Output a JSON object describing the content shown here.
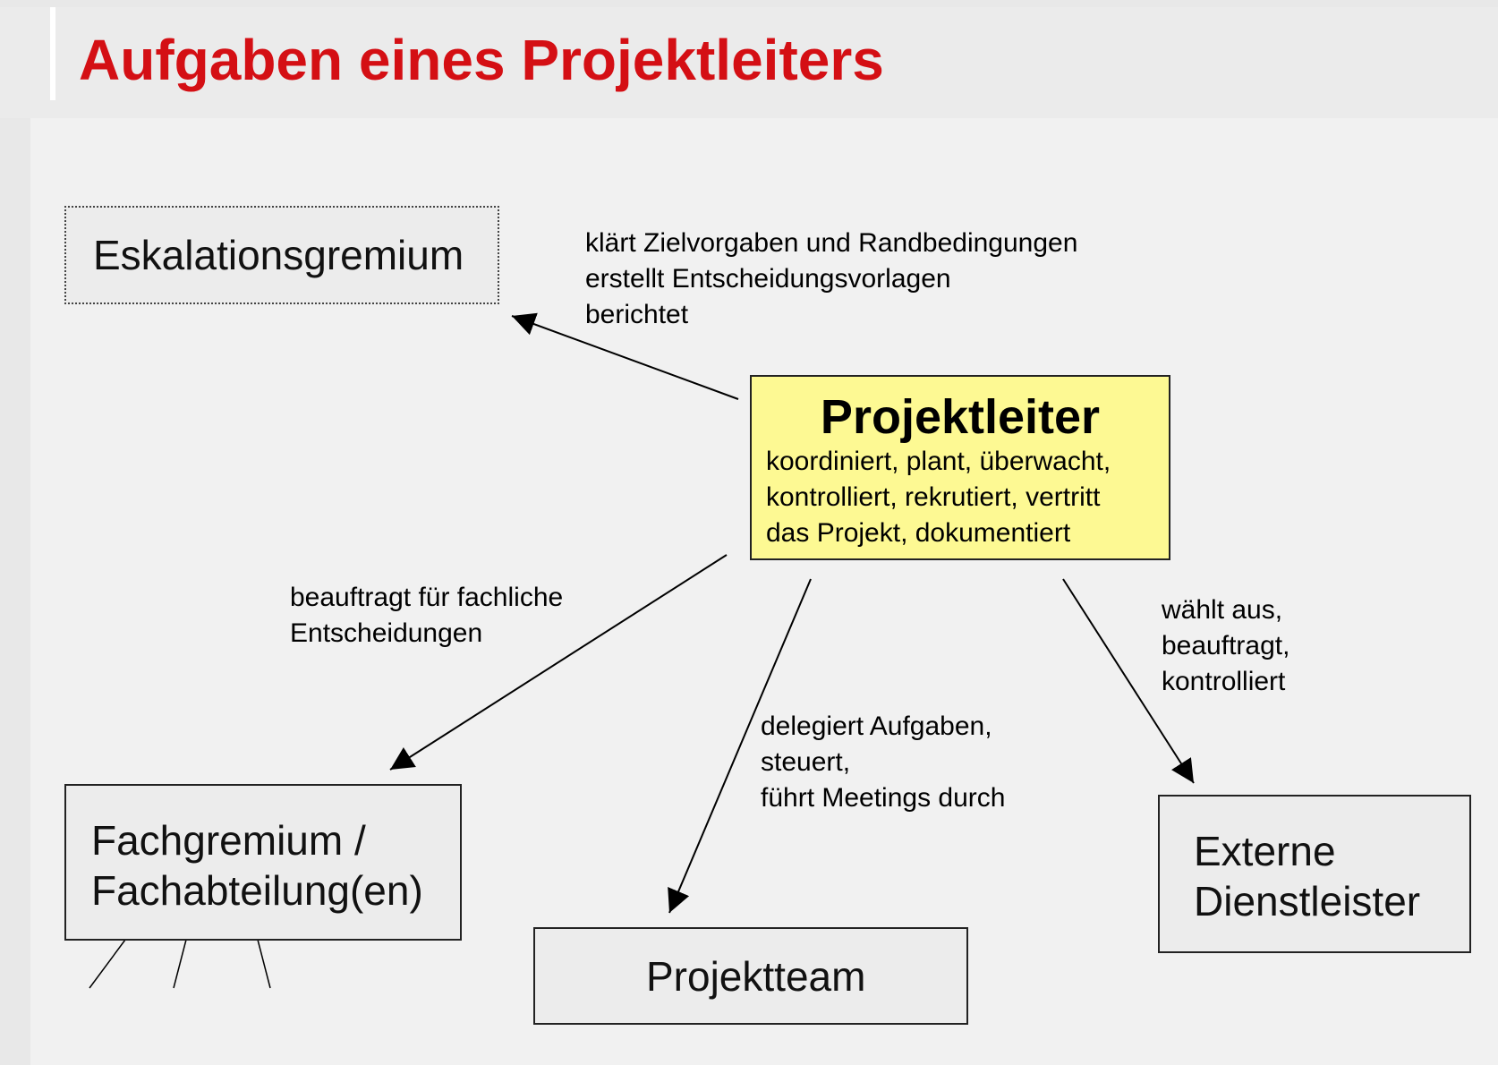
{
  "title": "Aufgaben eines Projektleiters",
  "nodes": {
    "center": {
      "title": "Projektleiter",
      "lines": [
        "koordiniert, plant, überwacht,",
        "kontrolliert, rekrutiert, vertritt",
        "das Projekt, dokumentiert"
      ]
    },
    "eskalation": {
      "label": "Eskalationsgremium"
    },
    "fachgremium": {
      "lines": [
        "Fachgremium /",
        "Fachabteilung(en)"
      ]
    },
    "projektteam": {
      "label": "Projektteam"
    },
    "extern": {
      "lines": [
        "Externe",
        "Dienstleister"
      ]
    }
  },
  "edges": {
    "to_eskalation": [
      "klärt Zielvorgaben und Randbedingungen",
      "erstellt Entscheidungsvorlagen",
      "berichtet"
    ],
    "to_fachgremium": [
      "beauftragt für fachliche",
      "Entscheidungen"
    ],
    "to_projektteam": [
      "delegiert Aufgaben,",
      "steuert,",
      "führt Meetings durch"
    ],
    "to_extern": [
      "wählt aus,",
      "beauftragt,",
      "kontrolliert"
    ]
  }
}
